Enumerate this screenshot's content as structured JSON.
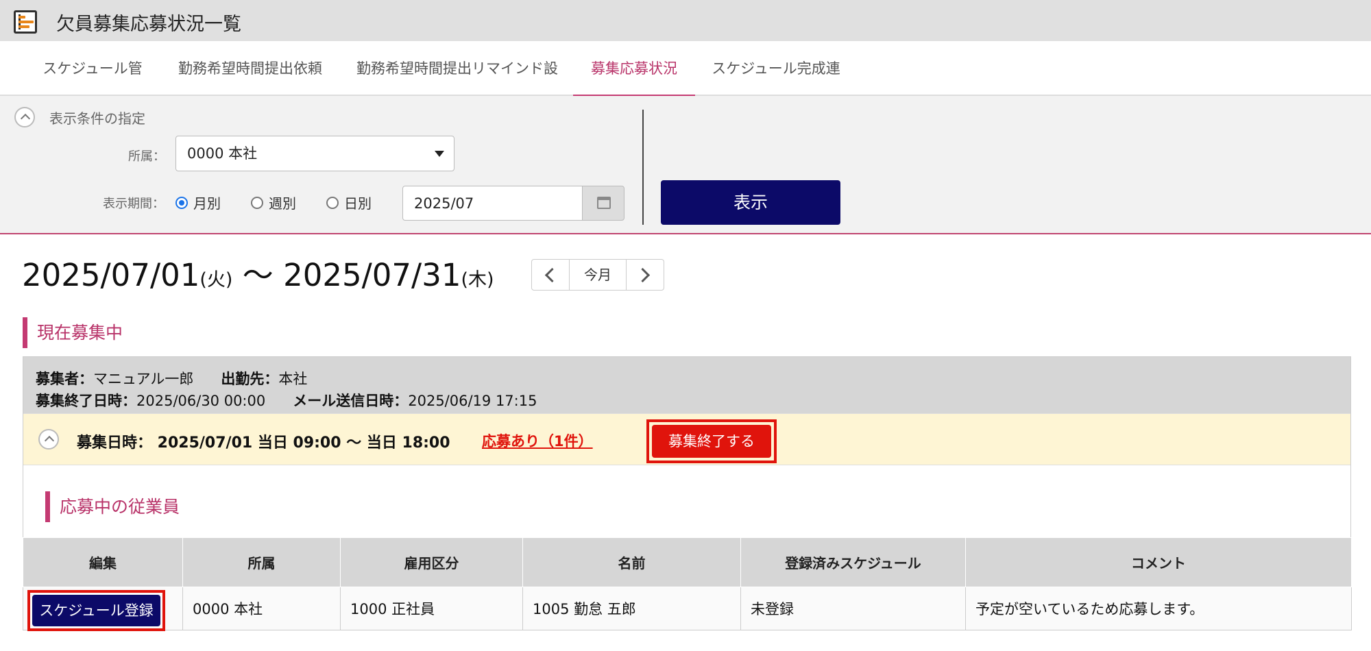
{
  "window": {
    "title": "欠員募集応募状況一覧"
  },
  "tabs": [
    {
      "label": "スケジュール管理"
    },
    {
      "label": "勤務希望時間提出依頼"
    },
    {
      "label": "勤務希望時間提出リマインド設定"
    },
    {
      "label": "募集応募状況",
      "active": true
    },
    {
      "label": "スケジュール完成連絡"
    }
  ],
  "filter": {
    "title": "表示条件の指定",
    "affiliation_label": "所属：",
    "affiliation_value": "0000 本社",
    "period_label": "表示期間：",
    "period_options": [
      {
        "label": "月別",
        "checked": true
      },
      {
        "label": "週別",
        "checked": false
      },
      {
        "label": "日別",
        "checked": false
      }
    ],
    "date_value": "2025/07",
    "show_button": "表示"
  },
  "period": {
    "start": "2025/07/01",
    "start_dow": "(火)",
    "separator": "〜",
    "end": "2025/07/31",
    "end_dow": "(木)",
    "today_button": "今月"
  },
  "recruiting": {
    "section_title": "現在募集中",
    "recruiter_label": "募集者：",
    "recruiter": "マニュアル一郎",
    "workplace_label": "出勤先：",
    "workplace": "本社",
    "end_label": "募集終了日時：",
    "end_datetime": "2025/06/30 00:00",
    "mail_label": "メール送信日時：",
    "mail_datetime": "2025/06/19 17:15",
    "recruit_datetime": "募集日時： 2025/07/01 当日 09:00 〜 当日 18:00",
    "response_link": "応募あり（1件）",
    "end_button": "募集終了する"
  },
  "applicants": {
    "section_title": "応募中の従業員",
    "columns": [
      "編集",
      "所属",
      "雇用区分",
      "名前",
      "登録済みスケジュール",
      "コメント"
    ],
    "rows": [
      {
        "edit_button": "スケジュール登録",
        "affiliation": "0000 本社",
        "employment": "1000 正社員",
        "name": "1005 勤怠 五郎",
        "registered": "未登録",
        "comment": "予定が空いているため応募します。"
      }
    ]
  }
}
